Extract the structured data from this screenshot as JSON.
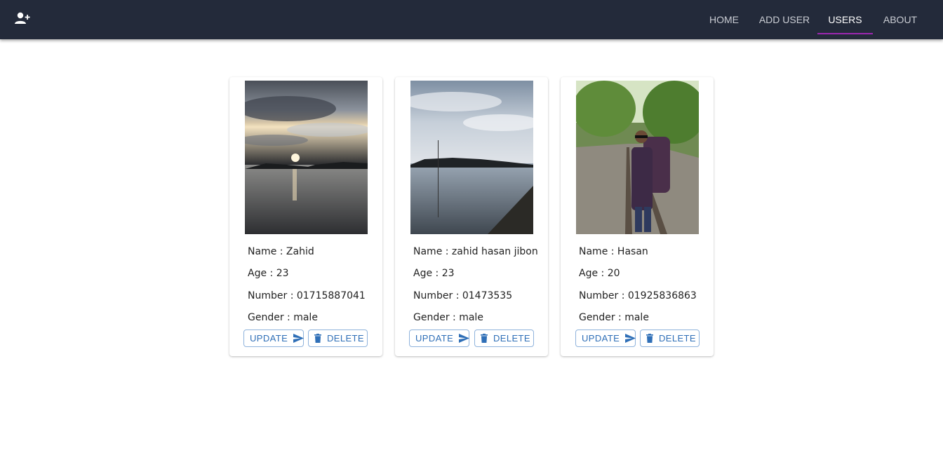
{
  "nav": {
    "logo_icon": "person-add-icon",
    "items": [
      {
        "label": "HOME",
        "active": false
      },
      {
        "label": "ADD USER",
        "active": false
      },
      {
        "label": "USERS",
        "active": true
      },
      {
        "label": "ABOUT",
        "active": false
      }
    ]
  },
  "colors": {
    "appbar": "#232a3a",
    "active_indicator": "#9c27b0",
    "button": "#2f6fb7"
  },
  "users": [
    {
      "name_line": "Name : Zahid",
      "age_line": "Age : 23",
      "number_line": "Number : 01715887041",
      "gender_line": "Gender : male",
      "update_label": "UPDATE",
      "delete_label": "DELETE"
    },
    {
      "name_line": "Name : zahid hasan jibon",
      "age_line": "Age : 23",
      "number_line": "Number : 01473535",
      "gender_line": "Gender : male",
      "update_label": "UPDATE",
      "delete_label": "DELETE"
    },
    {
      "name_line": "Name : Hasan",
      "age_line": "Age : 20",
      "number_line": "Number : 01925836863",
      "gender_line": "Gender : male",
      "update_label": "UPDATE",
      "delete_label": "DELETE"
    }
  ]
}
